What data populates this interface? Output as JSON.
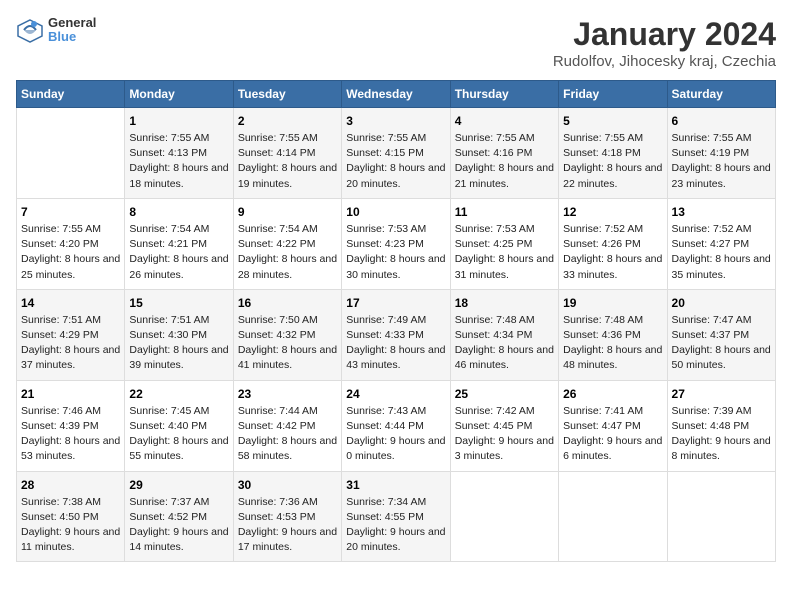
{
  "header": {
    "logo_line1": "General",
    "logo_line2": "Blue",
    "title": "January 2024",
    "subtitle": "Rudolfov, Jihocesky kraj, Czechia"
  },
  "days_of_week": [
    "Sunday",
    "Monday",
    "Tuesday",
    "Wednesday",
    "Thursday",
    "Friday",
    "Saturday"
  ],
  "weeks": [
    [
      {
        "day": "",
        "sunrise": "",
        "sunset": "",
        "daylight": ""
      },
      {
        "day": "1",
        "sunrise": "Sunrise: 7:55 AM",
        "sunset": "Sunset: 4:13 PM",
        "daylight": "Daylight: 8 hours and 18 minutes."
      },
      {
        "day": "2",
        "sunrise": "Sunrise: 7:55 AM",
        "sunset": "Sunset: 4:14 PM",
        "daylight": "Daylight: 8 hours and 19 minutes."
      },
      {
        "day": "3",
        "sunrise": "Sunrise: 7:55 AM",
        "sunset": "Sunset: 4:15 PM",
        "daylight": "Daylight: 8 hours and 20 minutes."
      },
      {
        "day": "4",
        "sunrise": "Sunrise: 7:55 AM",
        "sunset": "Sunset: 4:16 PM",
        "daylight": "Daylight: 8 hours and 21 minutes."
      },
      {
        "day": "5",
        "sunrise": "Sunrise: 7:55 AM",
        "sunset": "Sunset: 4:18 PM",
        "daylight": "Daylight: 8 hours and 22 minutes."
      },
      {
        "day": "6",
        "sunrise": "Sunrise: 7:55 AM",
        "sunset": "Sunset: 4:19 PM",
        "daylight": "Daylight: 8 hours and 23 minutes."
      }
    ],
    [
      {
        "day": "7",
        "sunrise": "Sunrise: 7:55 AM",
        "sunset": "Sunset: 4:20 PM",
        "daylight": "Daylight: 8 hours and 25 minutes."
      },
      {
        "day": "8",
        "sunrise": "Sunrise: 7:54 AM",
        "sunset": "Sunset: 4:21 PM",
        "daylight": "Daylight: 8 hours and 26 minutes."
      },
      {
        "day": "9",
        "sunrise": "Sunrise: 7:54 AM",
        "sunset": "Sunset: 4:22 PM",
        "daylight": "Daylight: 8 hours and 28 minutes."
      },
      {
        "day": "10",
        "sunrise": "Sunrise: 7:53 AM",
        "sunset": "Sunset: 4:23 PM",
        "daylight": "Daylight: 8 hours and 30 minutes."
      },
      {
        "day": "11",
        "sunrise": "Sunrise: 7:53 AM",
        "sunset": "Sunset: 4:25 PM",
        "daylight": "Daylight: 8 hours and 31 minutes."
      },
      {
        "day": "12",
        "sunrise": "Sunrise: 7:52 AM",
        "sunset": "Sunset: 4:26 PM",
        "daylight": "Daylight: 8 hours and 33 minutes."
      },
      {
        "day": "13",
        "sunrise": "Sunrise: 7:52 AM",
        "sunset": "Sunset: 4:27 PM",
        "daylight": "Daylight: 8 hours and 35 minutes."
      }
    ],
    [
      {
        "day": "14",
        "sunrise": "Sunrise: 7:51 AM",
        "sunset": "Sunset: 4:29 PM",
        "daylight": "Daylight: 8 hours and 37 minutes."
      },
      {
        "day": "15",
        "sunrise": "Sunrise: 7:51 AM",
        "sunset": "Sunset: 4:30 PM",
        "daylight": "Daylight: 8 hours and 39 minutes."
      },
      {
        "day": "16",
        "sunrise": "Sunrise: 7:50 AM",
        "sunset": "Sunset: 4:32 PM",
        "daylight": "Daylight: 8 hours and 41 minutes."
      },
      {
        "day": "17",
        "sunrise": "Sunrise: 7:49 AM",
        "sunset": "Sunset: 4:33 PM",
        "daylight": "Daylight: 8 hours and 43 minutes."
      },
      {
        "day": "18",
        "sunrise": "Sunrise: 7:48 AM",
        "sunset": "Sunset: 4:34 PM",
        "daylight": "Daylight: 8 hours and 46 minutes."
      },
      {
        "day": "19",
        "sunrise": "Sunrise: 7:48 AM",
        "sunset": "Sunset: 4:36 PM",
        "daylight": "Daylight: 8 hours and 48 minutes."
      },
      {
        "day": "20",
        "sunrise": "Sunrise: 7:47 AM",
        "sunset": "Sunset: 4:37 PM",
        "daylight": "Daylight: 8 hours and 50 minutes."
      }
    ],
    [
      {
        "day": "21",
        "sunrise": "Sunrise: 7:46 AM",
        "sunset": "Sunset: 4:39 PM",
        "daylight": "Daylight: 8 hours and 53 minutes."
      },
      {
        "day": "22",
        "sunrise": "Sunrise: 7:45 AM",
        "sunset": "Sunset: 4:40 PM",
        "daylight": "Daylight: 8 hours and 55 minutes."
      },
      {
        "day": "23",
        "sunrise": "Sunrise: 7:44 AM",
        "sunset": "Sunset: 4:42 PM",
        "daylight": "Daylight: 8 hours and 58 minutes."
      },
      {
        "day": "24",
        "sunrise": "Sunrise: 7:43 AM",
        "sunset": "Sunset: 4:44 PM",
        "daylight": "Daylight: 9 hours and 0 minutes."
      },
      {
        "day": "25",
        "sunrise": "Sunrise: 7:42 AM",
        "sunset": "Sunset: 4:45 PM",
        "daylight": "Daylight: 9 hours and 3 minutes."
      },
      {
        "day": "26",
        "sunrise": "Sunrise: 7:41 AM",
        "sunset": "Sunset: 4:47 PM",
        "daylight": "Daylight: 9 hours and 6 minutes."
      },
      {
        "day": "27",
        "sunrise": "Sunrise: 7:39 AM",
        "sunset": "Sunset: 4:48 PM",
        "daylight": "Daylight: 9 hours and 8 minutes."
      }
    ],
    [
      {
        "day": "28",
        "sunrise": "Sunrise: 7:38 AM",
        "sunset": "Sunset: 4:50 PM",
        "daylight": "Daylight: 9 hours and 11 minutes."
      },
      {
        "day": "29",
        "sunrise": "Sunrise: 7:37 AM",
        "sunset": "Sunset: 4:52 PM",
        "daylight": "Daylight: 9 hours and 14 minutes."
      },
      {
        "day": "30",
        "sunrise": "Sunrise: 7:36 AM",
        "sunset": "Sunset: 4:53 PM",
        "daylight": "Daylight: 9 hours and 17 minutes."
      },
      {
        "day": "31",
        "sunrise": "Sunrise: 7:34 AM",
        "sunset": "Sunset: 4:55 PM",
        "daylight": "Daylight: 9 hours and 20 minutes."
      },
      {
        "day": "",
        "sunrise": "",
        "sunset": "",
        "daylight": ""
      },
      {
        "day": "",
        "sunrise": "",
        "sunset": "",
        "daylight": ""
      },
      {
        "day": "",
        "sunrise": "",
        "sunset": "",
        "daylight": ""
      }
    ]
  ]
}
